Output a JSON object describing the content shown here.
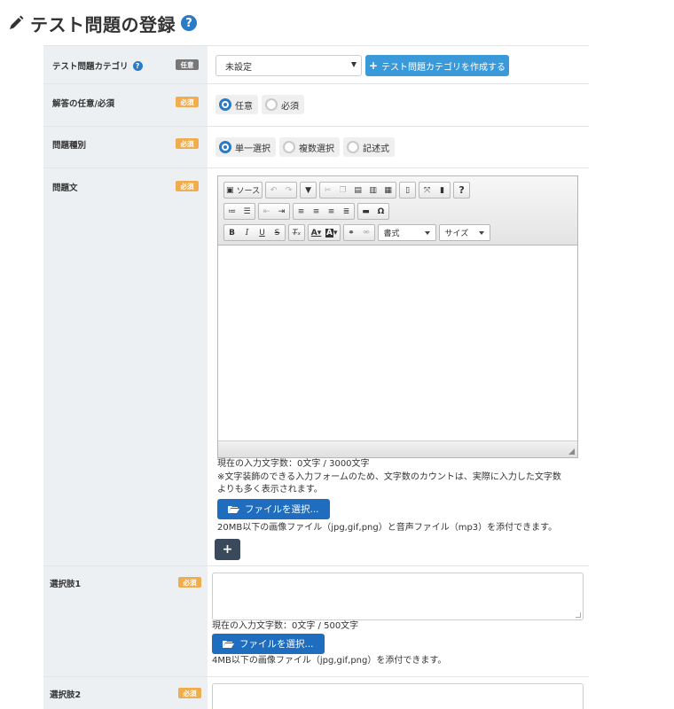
{
  "page": {
    "title": "テスト問題の登録",
    "help_glyph": "?"
  },
  "rows": {
    "category": {
      "label": "テスト問題カテゴリ",
      "badge": "任意",
      "select_value": "未設定",
      "create_button": "テスト問題カテゴリを作成する"
    },
    "answer_required": {
      "label": "解答の任意/必須",
      "badge": "必須",
      "options": [
        "任意",
        "必須"
      ],
      "selected": "任意"
    },
    "question_type": {
      "label": "問題種別",
      "badge": "必須",
      "options": [
        "単一選択",
        "複数選択",
        "記述式"
      ],
      "selected": "単一選択"
    },
    "question_text": {
      "label": "問題文",
      "badge": "必須",
      "toolbar": {
        "source_label": "ソース",
        "format_combo": "書式",
        "size_combo": "サイズ",
        "help_glyph": "?"
      },
      "char_count": "現在の入力文字数：0文字 / 3000文字",
      "note_line1": "※文字装飾のできる入力フォームのため、文字数のカウントは、実際に入力した文字数",
      "note_line2": "よりも多く表示されます。",
      "file_button": "ファイルを選択...",
      "file_note": "20MB以下の画像ファイル（jpg,gif,png）と音声ファイル（mp3）を添付できます。",
      "add_glyph": "+"
    },
    "choice1": {
      "label": "選択肢1",
      "badge": "必須",
      "char_count": "現在の入力文字数：0文字 / 500文字",
      "file_button": "ファイルを選択...",
      "file_note": "4MB以下の画像ファイル（jpg,gif,png）を添付できます。"
    },
    "choice2": {
      "label": "選択肢2",
      "badge": "必須"
    }
  },
  "icons": {
    "title": "pencil-icon",
    "help": "question-circle-icon",
    "create": "plus-icon",
    "file": "folder-open-icon"
  },
  "colors": {
    "primary": "#3a9ad9",
    "file_button": "#1f6dbf",
    "required_badge": "#f0ad4e",
    "optional_badge": "#777777",
    "label_bg": "#edf0f2",
    "add_button": "#3a4a5c"
  }
}
